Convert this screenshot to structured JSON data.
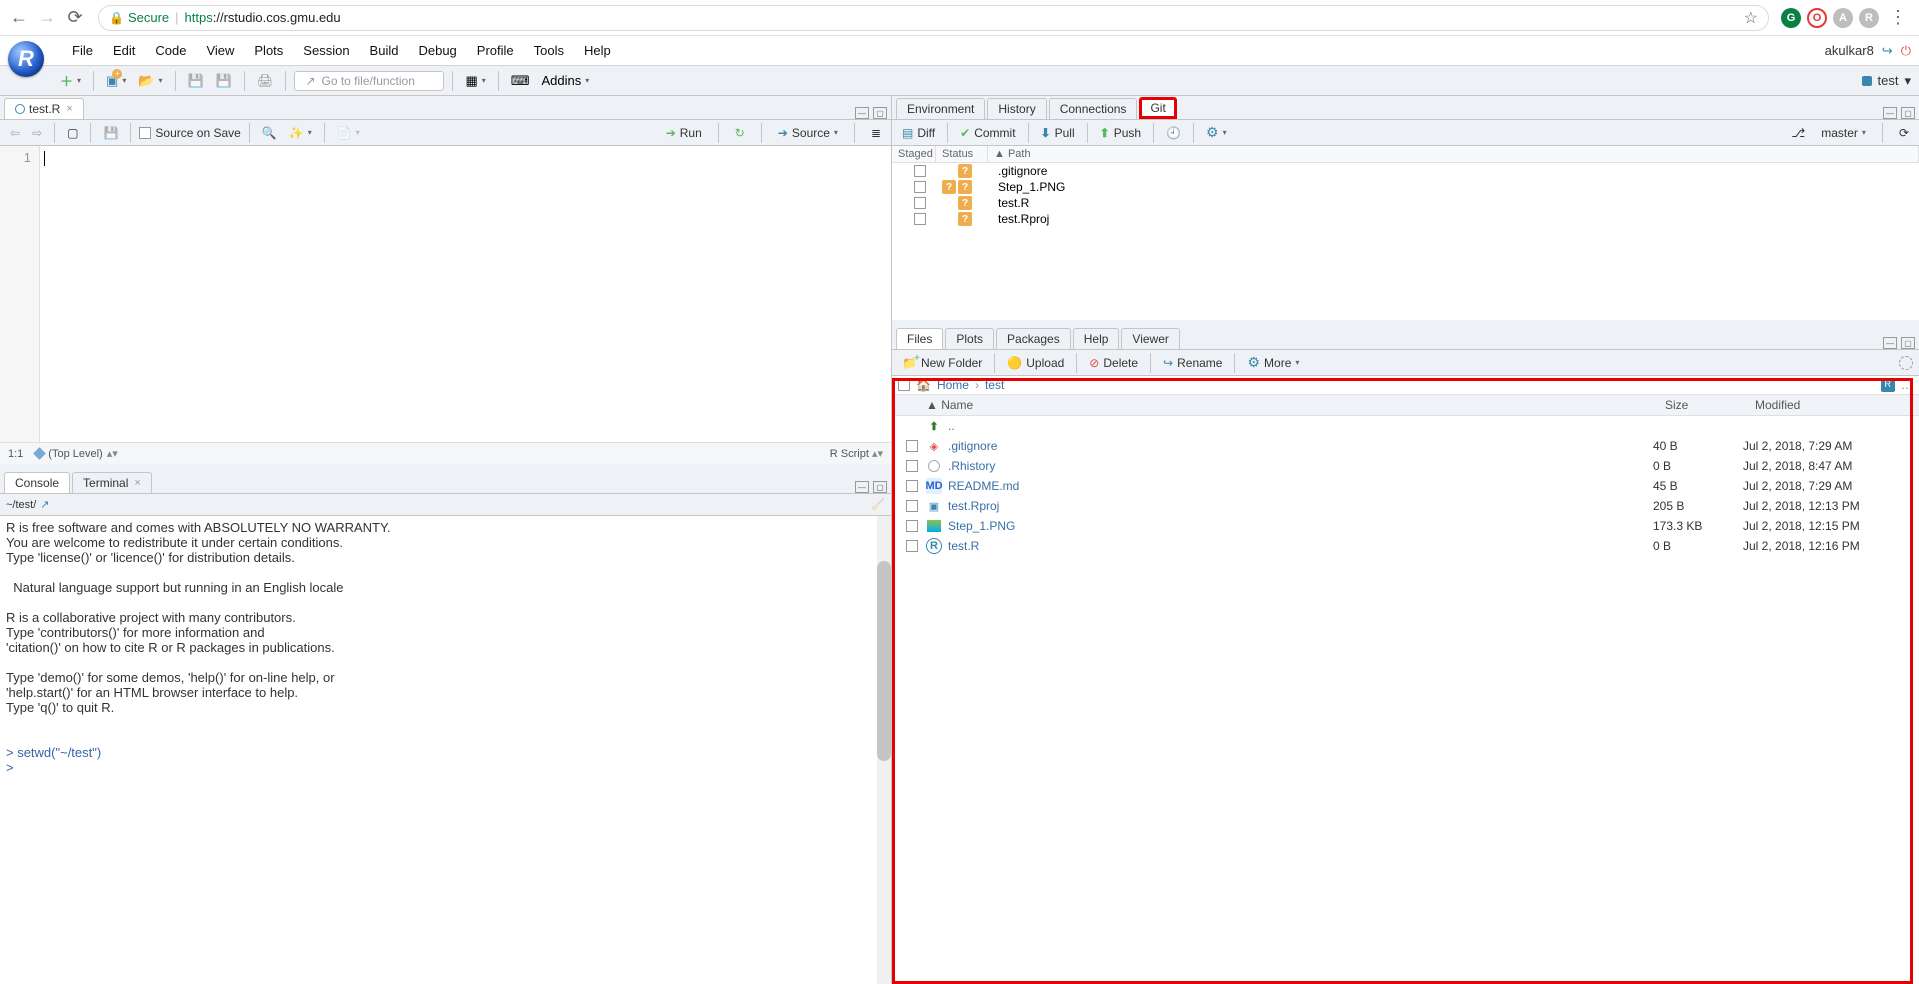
{
  "browser": {
    "secure": "Secure",
    "url_proto": "https",
    "url_rest": "://rstudio.cos.gmu.edu"
  },
  "header": {
    "menus": [
      "File",
      "Edit",
      "Code",
      "View",
      "Plots",
      "Session",
      "Build",
      "Debug",
      "Profile",
      "Tools",
      "Help"
    ],
    "user": "akulkar8"
  },
  "main_toolbar": {
    "goto_placeholder": "Go to file/function",
    "addins": "Addins",
    "project": "test"
  },
  "source": {
    "tab_name": "test.R",
    "save_on_source": "Source on Save",
    "run": "Run",
    "source_btn": "Source",
    "cursor": "1:1",
    "scope": "(Top Level)",
    "lang": "R Script",
    "line_no": "1"
  },
  "console": {
    "tabs": [
      "Console",
      "Terminal"
    ],
    "cwd": "~/test/",
    "body_lines": [
      "R is free software and comes with ABSOLUTELY NO WARRANTY.",
      "You are welcome to redistribute it under certain conditions.",
      "Type 'license()' or 'licence()' for distribution details.",
      "",
      "  Natural language support but running in an English locale",
      "",
      "R is a collaborative project with many contributors.",
      "Type 'contributors()' for more information and",
      "'citation()' on how to cite R or R packages in publications.",
      "",
      "Type 'demo()' for some demos, 'help()' for on-line help, or",
      "'help.start()' for an HTML browser interface to help.",
      "Type 'q()' to quit R.",
      ""
    ],
    "prompt1": "> setwd(\"~/test\")",
    "prompt2": "> "
  },
  "env_pane": {
    "tabs": [
      "Environment",
      "History",
      "Connections",
      "Git"
    ],
    "diff": "Diff",
    "commit": "Commit",
    "pull": "Pull",
    "push": "Push",
    "branch": "master",
    "head": {
      "staged": "Staged",
      "status": "Status",
      "path_prefix": "▲ ",
      "path": "Path"
    },
    "rows": [
      {
        "dual": false,
        "path": ".gitignore"
      },
      {
        "dual": true,
        "path": "Step_1.PNG"
      },
      {
        "dual": false,
        "path": "test.R"
      },
      {
        "dual": false,
        "path": "test.Rproj"
      }
    ]
  },
  "files_pane": {
    "tabs": [
      "Files",
      "Plots",
      "Packages",
      "Help",
      "Viewer"
    ],
    "new_folder": "New Folder",
    "upload": "Upload",
    "delete": "Delete",
    "rename": "Rename",
    "more": "More",
    "bc_home": "Home",
    "bc_cur": "test",
    "head": {
      "name": "▲ Name",
      "size": "Size",
      "mod": "Modified"
    },
    "up": "..",
    "rows": [
      {
        "icon": "git",
        "name": ".gitignore",
        "size": "40 B",
        "mod": "Jul 2, 2018, 7:29 AM"
      },
      {
        "icon": "hist",
        "name": ".Rhistory",
        "size": "0 B",
        "mod": "Jul 2, 2018, 8:47 AM"
      },
      {
        "icon": "md",
        "name": "README.md",
        "size": "45 B",
        "mod": "Jul 2, 2018, 7:29 AM"
      },
      {
        "icon": "rproj",
        "name": "test.Rproj",
        "size": "205 B",
        "mod": "Jul 2, 2018, 12:13 PM"
      },
      {
        "icon": "png",
        "name": "Step_1.PNG",
        "size": "173.3 KB",
        "mod": "Jul 2, 2018, 12:15 PM"
      },
      {
        "icon": "r",
        "name": "test.R",
        "size": "0 B",
        "mod": "Jul 2, 2018, 12:16 PM"
      }
    ]
  }
}
